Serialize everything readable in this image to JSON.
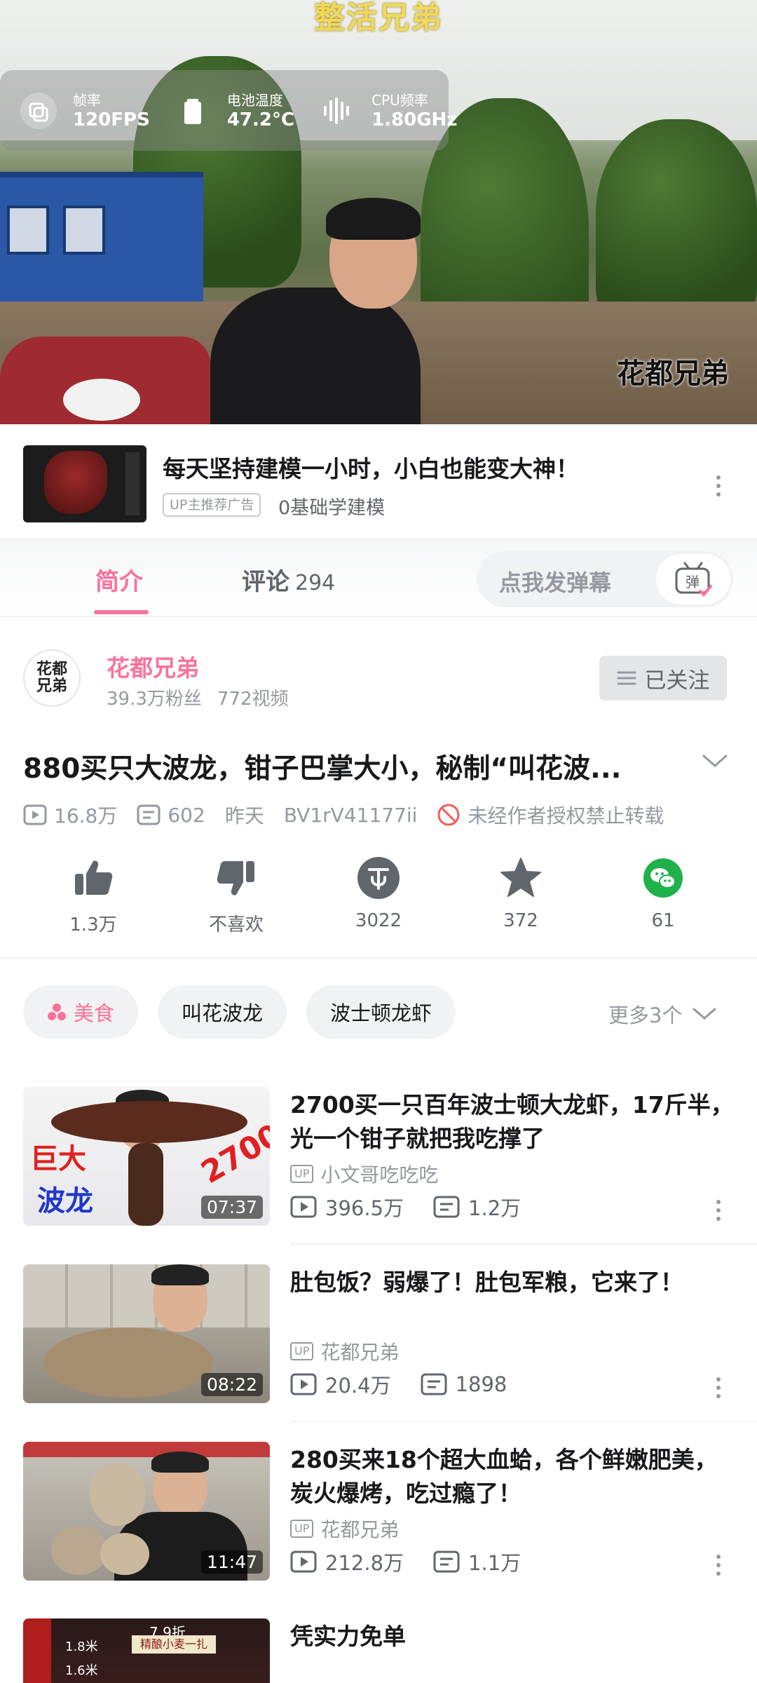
{
  "player": {
    "overlay_title": "整活兄弟",
    "watermark": "花都兄弟",
    "stats": [
      {
        "label": "帧率",
        "value": "120FPS",
        "icon": "layers-icon"
      },
      {
        "label": "电池温度",
        "value": "47.2°C",
        "icon": "battery-icon"
      },
      {
        "label": "CPU频率",
        "value": "1.80GHz",
        "icon": "waveform-icon"
      }
    ]
  },
  "ad": {
    "title": "每天坚持建模一小时，小白也能变大神！",
    "badge": "UP主推荐广告",
    "subtitle": "0基础学建模"
  },
  "tabs": {
    "intro": "简介",
    "comments": "评论",
    "comments_count": "294",
    "danmaku_placeholder": "点我发弹幕",
    "danmaku_button": "弹"
  },
  "uploader": {
    "avatar_text": "花都兄弟",
    "name": "花都兄弟",
    "fans": "39.3万粉丝",
    "videos": "772视频",
    "follow_label": "已关注"
  },
  "video": {
    "title": "880买只大波龙，钳子巴掌大小，秘制“叫花波...",
    "views": "16.8万",
    "danmaku": "602",
    "date": "昨天",
    "bvid": "BV1rV41177ii",
    "copyright": "未经作者授权禁止转载"
  },
  "actions": [
    {
      "label": "1.3万",
      "icon": "thumbs-up-icon"
    },
    {
      "label": "不喜欢",
      "icon": "thumbs-down-icon"
    },
    {
      "label": "3022",
      "icon": "coin-icon"
    },
    {
      "label": "372",
      "icon": "star-icon"
    },
    {
      "label": "61",
      "icon": "wechat-share-icon"
    }
  ],
  "tags": {
    "items": [
      "美食",
      "叫花波龙",
      "波士顿龙虾"
    ],
    "more": "更多3个"
  },
  "related": [
    {
      "title": "2700买一只百年波士顿大龙虾，17斤半，光一个钳子就把我吃撑了",
      "up": "小文哥吃吃吃",
      "views": "396.5万",
      "danmaku": "1.2万",
      "duration": "07:37",
      "thumb_text_1": "巨大",
      "thumb_text_2": "波龙",
      "thumb_text_3": "2700"
    },
    {
      "title": "肚包饭？弱爆了！肚包军粮，它来了！",
      "up": "花都兄弟",
      "views": "20.4万",
      "danmaku": "1898",
      "duration": "08:22"
    },
    {
      "title": "280买来18个超大血蛤，各个鲜嫩肥美，炭火爆烤，吃过瘾了！",
      "up": "花都兄弟",
      "views": "212.8万",
      "danmaku": "1.1万",
      "duration": "11:47"
    },
    {
      "title": "凭实力免单",
      "thumb_text_1": "7.9折",
      "thumb_text_2": "1.8米",
      "thumb_text_3": "精酿小麦一扎",
      "thumb_text_4": "1.6米"
    }
  ],
  "up_badge": "UP",
  "colors": {
    "accent": "#fb7299",
    "text": "#18191c",
    "muted": "#9499a0",
    "wechat": "#1fb14a"
  }
}
